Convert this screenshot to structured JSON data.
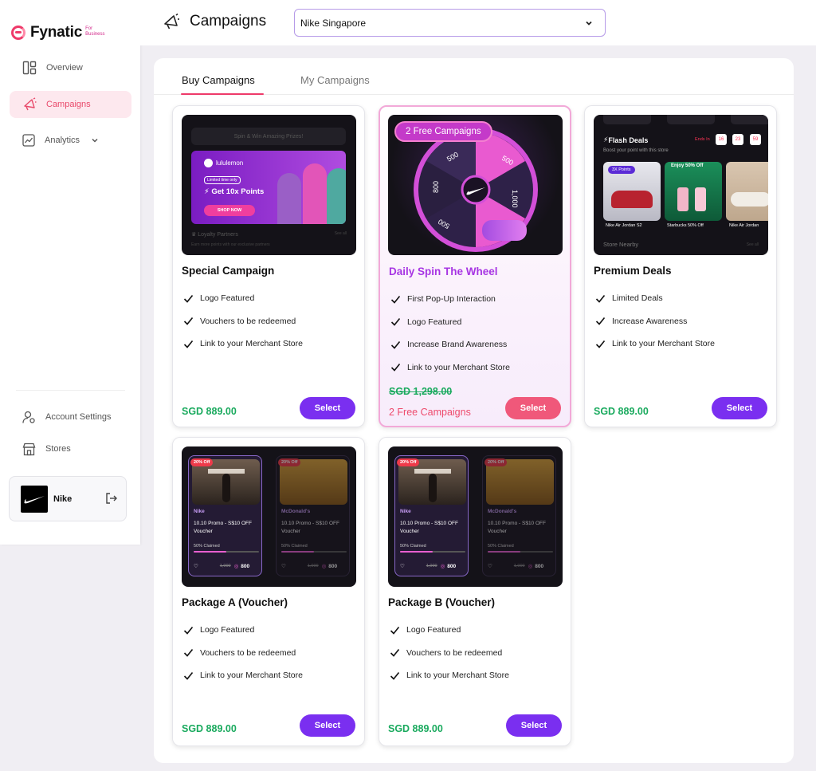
{
  "brand": {
    "name": "Fynatic",
    "sub_line1": "For",
    "sub_line2": "Business"
  },
  "sidebar": {
    "items": [
      {
        "label": "Overview"
      },
      {
        "label": "Campaigns"
      },
      {
        "label": "Analytics"
      },
      {
        "label": "Account Settings"
      },
      {
        "label": "Stores"
      }
    ],
    "account": {
      "name": "Nike"
    }
  },
  "header": {
    "title": "Campaigns",
    "store_select": "Nike Singapore"
  },
  "tabs": [
    {
      "label": "Buy Campaigns"
    },
    {
      "label": "My Campaigns"
    }
  ],
  "colors": {
    "accent_pink": "#ee3a6a",
    "select_purple": "#7a2ff0",
    "price_green": "#1aaa5e",
    "featured_title": "#a735e3"
  },
  "cards": [
    {
      "title": "Special Campaign",
      "features": [
        "Logo Featured",
        "Vouchers to be redeemed",
        "Link to your Merchant Store"
      ],
      "price": "SGD 889.00",
      "button": "Select",
      "thumb": {
        "bar_text": "Spin & Win Amazing Prizes!",
        "ad_brand": "lululemon",
        "ad_pill": "Limited time only",
        "ad_text": "Get 10x Points",
        "ad_button": "SHOP NOW",
        "footer_title": "Loyalty Partners",
        "footer_sub": "Earn more points with our exclusive partners",
        "see_all": "See all"
      }
    },
    {
      "title": "Daily Spin The Wheel",
      "features": [
        "First Pop-Up Interaction",
        "Logo Featured",
        "Increase Brand Awareness",
        "Link to your Merchant Store"
      ],
      "price_old": "SGD 1,298.00",
      "promo_note": "2 Free Campaigns",
      "button": "Select",
      "thumb": {
        "badge": "2 Free Campaigns",
        "wheel_values": [
          "500",
          "1,000",
          "800",
          "500",
          "800",
          "500"
        ]
      }
    },
    {
      "title": "Premium Deals",
      "features": [
        "Limited Deals",
        "Increase Awareness",
        "Link to your Merchant Store"
      ],
      "price": "SGD 889.00",
      "button": "Select",
      "thumb": {
        "title": "Flash Deals",
        "sub": "Boost your point with this store",
        "ends_in": "Ends In",
        "timer": [
          "16",
          "23",
          "59"
        ],
        "tag_points": "3X Points",
        "tag_offer": "Enjoy 50% Off",
        "items": [
          "Nike Air Jordan S2",
          "Starbucks 50% Off",
          "Nike Air Jordan"
        ],
        "nearby": "Store Nearby",
        "see_all": "See all"
      }
    },
    {
      "title": "Package A (Voucher)",
      "features": [
        "Logo Featured",
        "Vouchers to be redeemed",
        "Link to your Merchant Store"
      ],
      "price": "SGD 889.00",
      "button": "Select",
      "thumb": {
        "v1": {
          "discount": "20% Off",
          "brand": "Nike",
          "name": "10.10 Promo - S$10 OFF Voucher",
          "claimed": "50% Claimed",
          "claimed_fraction": 0.5,
          "old": "1,000",
          "pts": "800"
        },
        "v2": {
          "discount": "20% Off",
          "brand": "McDonald's",
          "name": "10.10 Promo - S$10 OFF Voucher",
          "claimed": "50% Claimed",
          "claimed_fraction": 0.5,
          "old": "1,000",
          "pts": "800"
        }
      }
    },
    {
      "title": "Package B (Voucher)",
      "features": [
        "Logo Featured",
        "Vouchers to be redeemed",
        "Link to your Merchant Store"
      ],
      "price": "SGD 889.00",
      "button": "Select",
      "thumb": {
        "v1": {
          "discount": "20% Off",
          "brand": "Nike",
          "name": "10.10 Promo - S$10 OFF Voucher",
          "claimed": "50% Claimed",
          "claimed_fraction": 0.5,
          "old": "1,000",
          "pts": "800"
        },
        "v2": {
          "discount": "20% Off",
          "brand": "McDonald's",
          "name": "10.10 Promo - S$10 OFF Voucher",
          "claimed": "50% Claimed",
          "claimed_fraction": 0.5,
          "old": "1,000",
          "pts": "800"
        }
      }
    }
  ]
}
